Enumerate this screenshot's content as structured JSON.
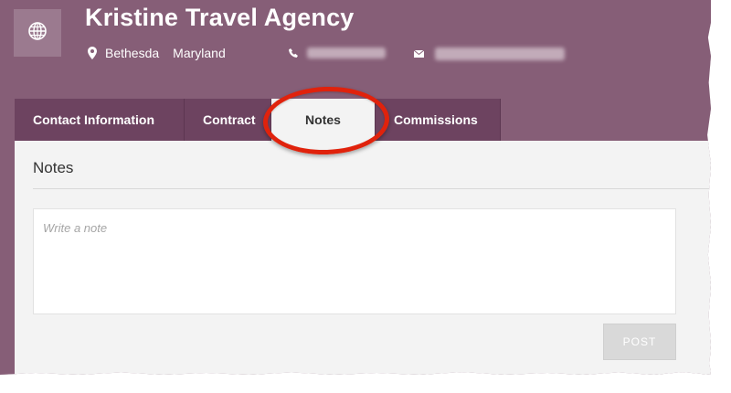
{
  "header": {
    "globe_icon": "globe-icon",
    "title": "Kristine Travel Agency",
    "location": {
      "icon": "map-pin-icon",
      "city": "Bethesda",
      "state": "Maryland"
    },
    "phone": {
      "icon": "phone-icon"
    },
    "email": {
      "icon": "envelope-icon"
    }
  },
  "tabs": [
    {
      "label": "Contact Information",
      "active": false
    },
    {
      "label": "Contract",
      "active": false
    },
    {
      "label": "Notes",
      "active": true
    },
    {
      "label": "Commissions",
      "active": false
    }
  ],
  "notes_panel": {
    "title": "Notes",
    "input": {
      "placeholder": "Write a note",
      "value": ""
    },
    "post_label": "POST"
  },
  "annotation": {
    "color": "#e0220c",
    "target": "Notes tab"
  },
  "colors": {
    "brand": "#865e77",
    "tab_bg": "#6d4360",
    "panel_bg": "#f3f3f3",
    "button_disabled": "#d9d9d9"
  }
}
